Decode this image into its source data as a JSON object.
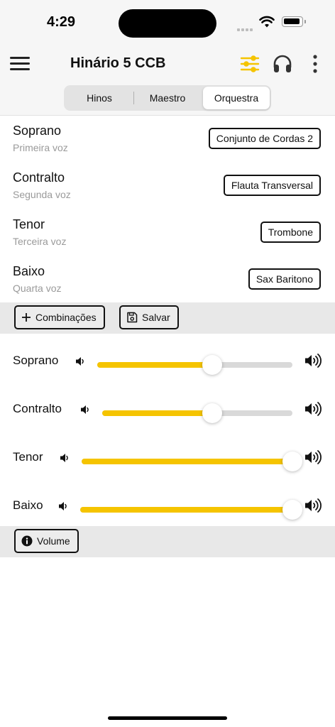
{
  "status": {
    "time": "4:29"
  },
  "header": {
    "title": "Hinário 5 CCB",
    "accent": "#f5c400"
  },
  "tabs": [
    {
      "label": "Hinos",
      "active": false
    },
    {
      "label": "Maestro",
      "active": false
    },
    {
      "label": "Orquestra",
      "active": true
    }
  ],
  "voices": [
    {
      "name": "Soprano",
      "subtitle": "Primeira voz",
      "instrument": "Conjunto de Cordas 2"
    },
    {
      "name": "Contralto",
      "subtitle": "Segunda voz",
      "instrument": "Flauta Transversal"
    },
    {
      "name": "Tenor",
      "subtitle": "Terceira voz",
      "instrument": "Trombone"
    },
    {
      "name": "Baixo",
      "subtitle": "Quarta voz",
      "instrument": "Sax Baritono"
    }
  ],
  "toolbar": {
    "combinations_label": "Combinações",
    "save_label": "Salvar"
  },
  "volumes": [
    {
      "name": "Soprano",
      "level": 0.59
    },
    {
      "name": "Contralto",
      "level": 0.58
    },
    {
      "name": "Tenor",
      "level": 1.0
    },
    {
      "name": "Baixo",
      "level": 1.0
    }
  ],
  "volume_button": {
    "label": "Volume"
  }
}
